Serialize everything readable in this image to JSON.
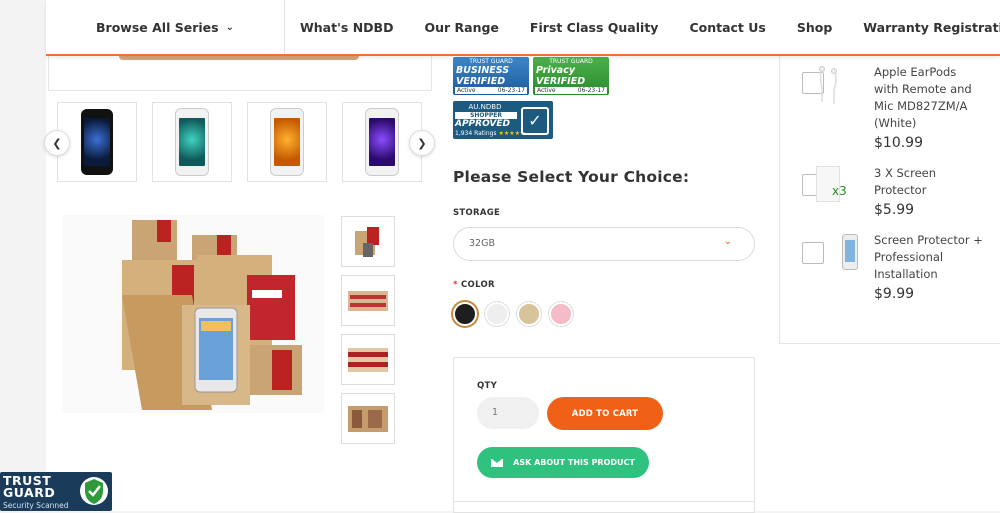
{
  "header": {
    "browse_label": "Browse All Series",
    "nav": [
      "What's NDBD",
      "Our Range",
      "First Class Quality",
      "Contact Us",
      "Shop",
      "Warranty Registration"
    ]
  },
  "badges": {
    "business": {
      "top": "TRUST GUARD",
      "title": "BUSINESS VERIFIED",
      "status": "Active",
      "date": "06-23-17"
    },
    "privacy": {
      "top": "TRUST GUARD",
      "title": "Privacy VERIFIED",
      "status": "Active",
      "date": "06-23-17"
    },
    "shopper": {
      "site": "AU.NDBD",
      "line1": "SHOPPER",
      "line2": "APPROVED",
      "ratings": "1,934 Ratings"
    }
  },
  "product": {
    "choice_title": "Please Select Your Choice:",
    "storage_label": "STORAGE",
    "storage_value": "32GB",
    "color_required": "*",
    "color_label": "COLOR",
    "colors": [
      "#1e1e1e",
      "#eeeeee",
      "#d8c49a",
      "#f3bcc6"
    ],
    "qty_label": "QTY",
    "qty_value": "1",
    "add_to_cart": "ADD TO CART",
    "ask": "ASK ABOUT THIS PRODUCT"
  },
  "addons": [
    {
      "name": "Apple EarPods with Remote and Mic MD827ZM/A (White)",
      "price": "$10.99"
    },
    {
      "name": "3 X Screen Protector",
      "price": "$5.99",
      "img_label": "x3"
    },
    {
      "name": "Screen Protector + Professional Installation",
      "price": "$9.99"
    }
  ],
  "trust_footer": {
    "title": "TRUST GUARD",
    "subtitle": "Security Scanned"
  },
  "colors": {
    "accent": "#f06017",
    "green": "#2ec27e",
    "header_border": "#e8743a"
  }
}
